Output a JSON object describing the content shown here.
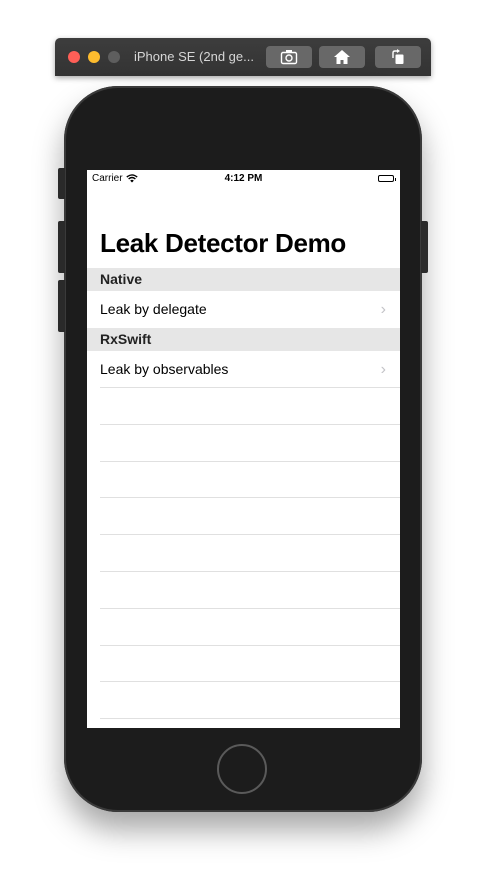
{
  "window": {
    "title": "iPhone SE (2nd ge..."
  },
  "status_bar": {
    "carrier": "Carrier",
    "time": "4:12 PM"
  },
  "navigation": {
    "large_title": "Leak Detector Demo"
  },
  "sections": [
    {
      "header": "Native",
      "rows": [
        {
          "label": "Leak by delegate"
        }
      ]
    },
    {
      "header": "RxSwift",
      "rows": [
        {
          "label": "Leak by observables"
        }
      ]
    }
  ],
  "icons": {
    "chevron": "chevron-right-icon"
  },
  "colors": {
    "section_header_bg": "#e6e6e6",
    "device_frame": "#1c1c1c",
    "titlebar": "#383838"
  }
}
